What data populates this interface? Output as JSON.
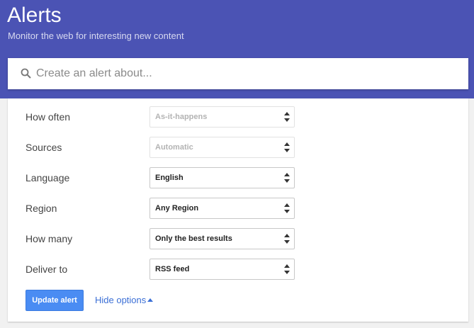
{
  "header": {
    "title": "Alerts",
    "subtitle": "Monitor the web for interesting new content"
  },
  "search": {
    "placeholder": "Create an alert about...",
    "value": "",
    "icon": "search-icon"
  },
  "options": [
    {
      "label": "How often",
      "value": "As-it-happens",
      "disabled": true
    },
    {
      "label": "Sources",
      "value": "Automatic",
      "disabled": true
    },
    {
      "label": "Language",
      "value": "English",
      "disabled": false
    },
    {
      "label": "Region",
      "value": "Any Region",
      "disabled": false
    },
    {
      "label": "How many",
      "value": "Only the best results",
      "disabled": false
    },
    {
      "label": "Deliver to",
      "value": "RSS feed",
      "disabled": false
    }
  ],
  "actions": {
    "update_label": "Update alert",
    "hide_options_label": "Hide options"
  },
  "colors": {
    "header_bg": "#4b53b4",
    "button_bg": "#4a8cf3",
    "link": "#3b6fd6"
  }
}
